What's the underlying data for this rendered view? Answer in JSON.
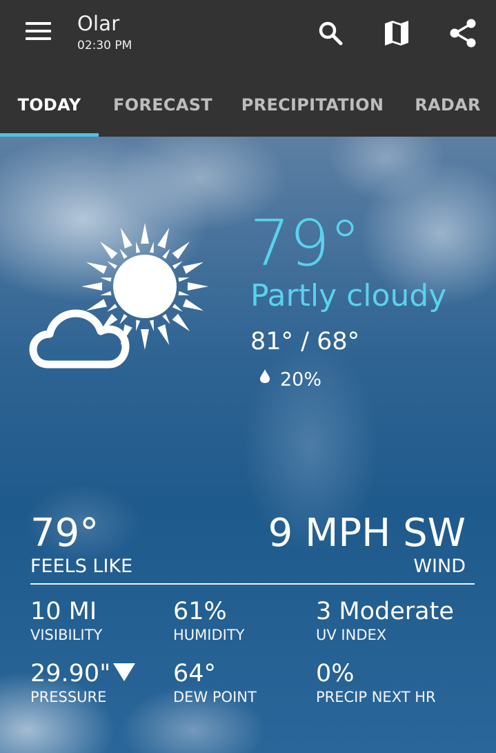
{
  "header": {
    "location": "Olar",
    "time": "02:30 PM",
    "icons": {
      "menu": "hamburger-menu-icon",
      "search": "search-icon",
      "map": "map-icon",
      "share": "share-icon"
    }
  },
  "tabs": [
    {
      "label": "TODAY",
      "active": true
    },
    {
      "label": "FORECAST",
      "active": false
    },
    {
      "label": "PRECIPITATION",
      "active": false
    },
    {
      "label": "RADAR",
      "active": false
    }
  ],
  "current": {
    "icon": "partly-cloudy-icon",
    "temperature": "79°",
    "condition": "Partly cloudy",
    "high_low": "81° / 68°",
    "precip_chance": "20%",
    "precip_icon": "raindrop-icon"
  },
  "details": {
    "feels_like": {
      "value": "79°",
      "label": "FEELS LIKE"
    },
    "wind": {
      "value": "9 MPH SW",
      "label": "WIND"
    },
    "visibility": {
      "value": "10 MI",
      "label": "VISIBILITY"
    },
    "humidity": {
      "value": "61%",
      "label": "HUMIDITY"
    },
    "uv_index": {
      "value": "3 Moderate",
      "label": "UV INDEX"
    },
    "pressure": {
      "value": "29.90\"",
      "label": "PRESSURE",
      "trend": "down"
    },
    "dew_point": {
      "value": "64°",
      "label": "DEW POINT"
    },
    "precip_next_hr": {
      "value": "0%",
      "label": "PRECIP NEXT HR"
    }
  },
  "colors": {
    "appbar": "#333333",
    "accent": "#4dc3e0",
    "temp_text": "#5ad2ee"
  }
}
